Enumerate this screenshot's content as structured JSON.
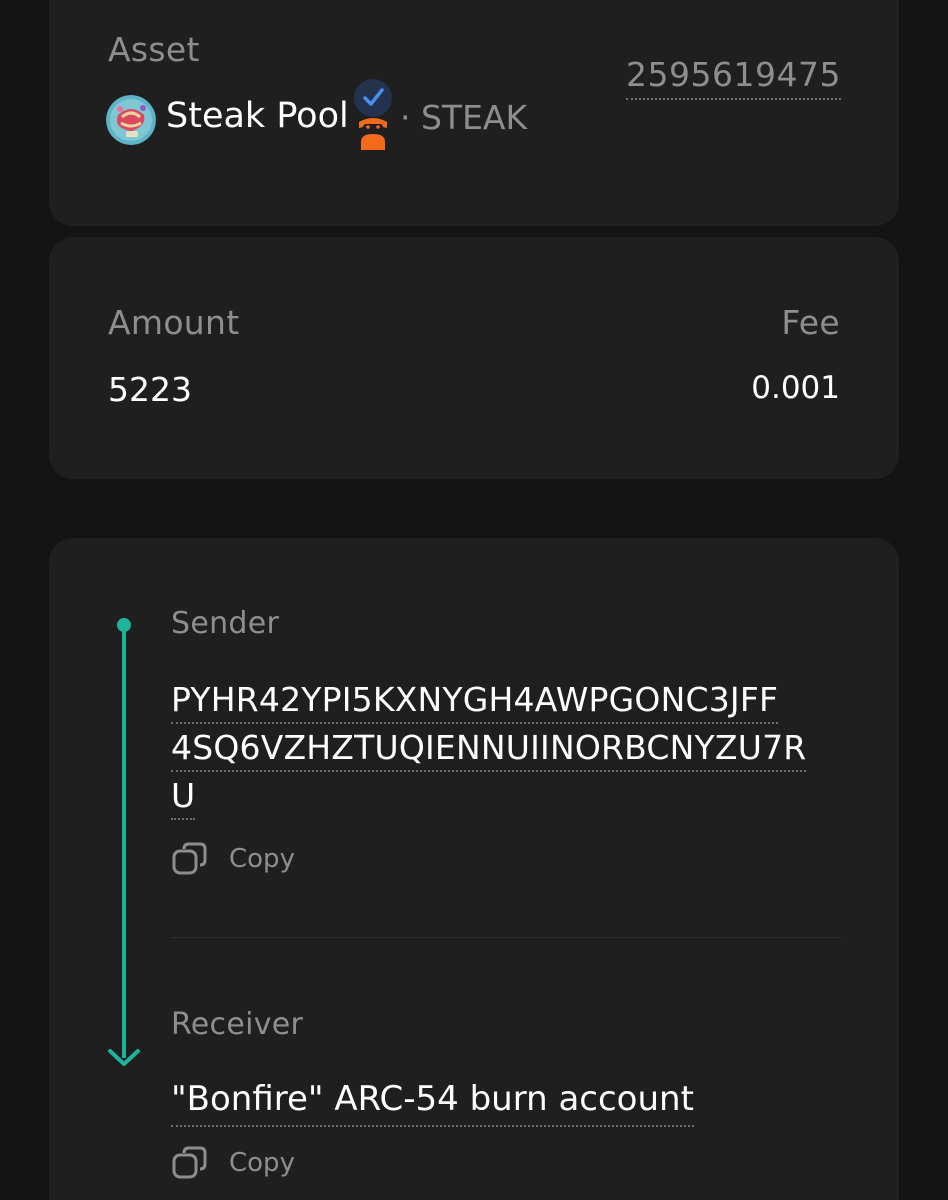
{
  "asset": {
    "label": "Asset",
    "name": "Steak Pool",
    "unit": "· STEAK",
    "id": "2595619475",
    "icons": [
      "asset-avatar",
      "verified-check-icon",
      "ninja-icon"
    ]
  },
  "amount": {
    "label": "Amount",
    "value": "5223",
    "fee_label": "Fee",
    "fee_value": "0.001"
  },
  "transfer": {
    "sender_label": "Sender",
    "sender_address": "PYHR42YPI5KXNYGH4AWPGONC3JFF4SQ6VZHZTUQIENNUIINORBCNYZU7RU",
    "sender_lines": [
      "PYHR42YPI5KXNYGH4AWPGONC3JFF",
      "4SQ6VZHZTUQIENNUIINORBCNYZU7R",
      "U"
    ],
    "copy_label": "Copy",
    "receiver_label": "Receiver",
    "receiver_name": "\"Bonfire\" ARC-54 burn account",
    "receiver_copy_label": "Copy"
  },
  "colors": {
    "background": "#141414",
    "card": "#1f1f1f",
    "accent": "#1fb39a",
    "muted_text": "#8e8e8e",
    "verified_blue": "#2f6fd6",
    "ninja_orange": "#f36a1d"
  }
}
